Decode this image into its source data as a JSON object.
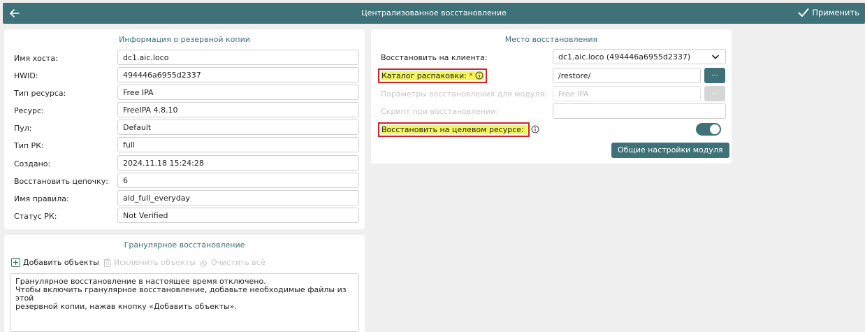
{
  "header": {
    "title": "Централизованное восстановление",
    "apply_label": "Применить"
  },
  "backup_info": {
    "title": "Информация о резервной копии",
    "rows": [
      {
        "label": "Имя хоста:",
        "value": "dc1.aic.loco"
      },
      {
        "label": "HWID:",
        "value": "494446a6955d2337"
      },
      {
        "label": "Тип ресурса:",
        "value": "Free IPA"
      },
      {
        "label": "Ресурс:",
        "value": "FreeIPA 4.8.10"
      },
      {
        "label": "Пул:",
        "value": "Default"
      },
      {
        "label": "Тип РК:",
        "value": "full"
      },
      {
        "label": "Создано:",
        "value": "2024.11.18 15:24:28"
      },
      {
        "label": "Восстановить цепочку:",
        "value": "6"
      },
      {
        "label": "Имя правила:",
        "value": "ald_full_everyday"
      },
      {
        "label": "Статус РК:",
        "value": "Not Verified"
      }
    ]
  },
  "restore_place": {
    "title": "Место восстановления",
    "client_label": "Восстановить на клиента:",
    "client_value": "dc1.aic.loco (494446a6955d2337)",
    "unpack_label": "Каталог распаковки:",
    "unpack_required": "*",
    "unpack_value": "/restore/",
    "module_params_label": "Параметры восстановления для модуля:",
    "module_params_value": "Free IPA",
    "script_label": "Скрипт при восстановлении:",
    "script_value": "",
    "target_label": "Восстановить на целевом ресурсе:",
    "target_enabled": true,
    "browse_label": "...",
    "module_settings_label": "Общие настройки модуля"
  },
  "granular": {
    "title": "Гранулярное восстановление",
    "add_label": "Добавить объекты",
    "exclude_label": "Исключить объекты",
    "clear_label": "Очистить всё",
    "message_line1": "Гранулярное восстановление в настоящее время отключено.",
    "message_line2": "Чтобы включить гранулярное восстановление, добавьте необходимые файлы из этой",
    "message_line3": "резервной копии, нажав кнопку «Добавить объекты»."
  }
}
